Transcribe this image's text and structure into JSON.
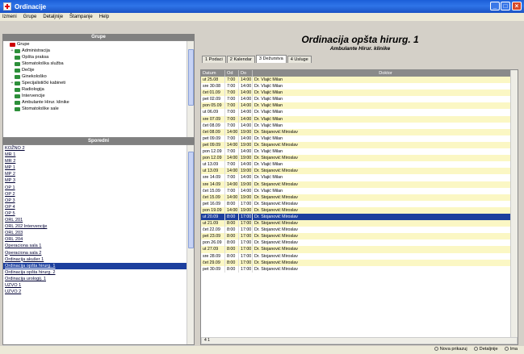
{
  "window": {
    "title": "Ordinacije"
  },
  "menu": [
    "Izmeni",
    "Grupe",
    "Detaljnije",
    "Štampanje",
    "Help"
  ],
  "left": {
    "groups_header": "Grupe",
    "tree": [
      {
        "label": "Grupe",
        "level": 0,
        "expander": "",
        "icon": "red"
      },
      {
        "label": "Administracija",
        "level": 1,
        "expander": "+",
        "icon": "green"
      },
      {
        "label": "Opšta praksa",
        "level": 1,
        "expander": "",
        "icon": "green"
      },
      {
        "label": "Stomatološka služba",
        "level": 1,
        "expander": "",
        "icon": "green"
      },
      {
        "label": "Dečije",
        "level": 1,
        "expander": "",
        "icon": "green"
      },
      {
        "label": "Ginekološko",
        "level": 1,
        "expander": "",
        "icon": "green"
      },
      {
        "label": "Specijalistički kabineti",
        "level": 1,
        "expander": "+",
        "icon": "green"
      },
      {
        "label": "Radiologija",
        "level": 1,
        "expander": "",
        "icon": "green"
      },
      {
        "label": "Intervencije",
        "level": 1,
        "expander": "",
        "icon": "green"
      },
      {
        "label": "Ambulante Hirur. klinike",
        "level": 1,
        "expander": "",
        "icon": "green"
      },
      {
        "label": "Stomatološke sale",
        "level": 1,
        "expander": "",
        "icon": "green"
      }
    ],
    "items_header": "Sporedni",
    "items": [
      "KOŽNO 2",
      "MR 1",
      "MR 2",
      "MP 1",
      "MP 2",
      "MP 3",
      "OP 1",
      "OP 2",
      "OP 3",
      "OP 4",
      "OP 5",
      "ORL 201",
      "ORL 202 Intervencije",
      "ORL 203",
      "ORL 204",
      "Operaciona sala 1",
      "Operaciona sala 2",
      "Ordinacija akušer 1",
      "Ordinacija opšta hirurg. 1",
      "Ordinacija opšta hirurg. 2",
      "Ordinacija urologij. 1",
      "UZVO 1",
      "UZVO 2"
    ],
    "selected_item_index": 18
  },
  "right": {
    "title": "Ordinacija opšta hirurg. 1",
    "subtitle": "Ambulante Hirur. klinike",
    "tabs": [
      "1 Podaci",
      "2 Kalendar",
      "3 Dežurstva",
      "4 Usluge"
    ],
    "active_tab": 2,
    "grid_headers": [
      "Datum",
      "Od",
      "Do",
      "Doktor"
    ],
    "rows": [
      [
        "ut 25.08",
        "7:00",
        "14:00",
        "Dr. Vlajić Milan"
      ],
      [
        "sre 30.08",
        "7:00",
        "14:00",
        "Dr. Vlajić Milan"
      ],
      [
        "čet 01.09",
        "7:00",
        "14:00",
        "Dr. Vlajić Milan"
      ],
      [
        "pet 02.09",
        "7:00",
        "14:00",
        "Dr. Vlajić Milan"
      ],
      [
        "pon 05.09",
        "7:00",
        "14:00",
        "Dr. Vlajić Milan"
      ],
      [
        "ut 06.09",
        "7:00",
        "14:00",
        "Dr. Vlajić Milan"
      ],
      [
        "sre 07.09",
        "7:00",
        "14:00",
        "Dr. Vlajić Milan"
      ],
      [
        "čet 08.09",
        "7:00",
        "14:00",
        "Dr. Vlajić Milan"
      ],
      [
        "čet 08.09",
        "14:00",
        "19:00",
        "Dr. Stojanović Miroslav"
      ],
      [
        "pet 09.09",
        "7:00",
        "14:00",
        "Dr. Vlajić Milan"
      ],
      [
        "pet 09.09",
        "14:00",
        "19:00",
        "Dr. Stojanović Miroslav"
      ],
      [
        "pon 12.09",
        "7:00",
        "14:00",
        "Dr. Vlajić Milan"
      ],
      [
        "pon 12.09",
        "14:00",
        "19:00",
        "Dr. Stojanović Miroslav"
      ],
      [
        "ut 13.09",
        "7:00",
        "14:00",
        "Dr. Vlajić Milan"
      ],
      [
        "ut 13.09",
        "14:00",
        "19:00",
        "Dr. Stojanović Miroslav"
      ],
      [
        "sre 14.09",
        "7:00",
        "14:00",
        "Dr. Vlajić Milan"
      ],
      [
        "sre 14.09",
        "14:00",
        "19:00",
        "Dr. Stojanović Miroslav"
      ],
      [
        "čet 15.09",
        "7:00",
        "14:00",
        "Dr. Vlajić Milan"
      ],
      [
        "čet 15.09",
        "14:00",
        "19:00",
        "Dr. Stojanović Miroslav"
      ],
      [
        "pet 16.09",
        "8:00",
        "17:00",
        "Dr. Stojanović Miroslav"
      ],
      [
        "pon 19.09",
        "14:00",
        "19:00",
        "Dr. Stojanović Miroslav"
      ],
      [
        "ut 20.09",
        "8:00",
        "17:00",
        "Dr. Stojanović Miroslav"
      ],
      [
        "ut 21.09",
        "8:00",
        "17:00",
        "Dr. Stojanović Miroslav"
      ],
      [
        "čet 22.09",
        "8:00",
        "17:00",
        "Dr. Stojanović Miroslav"
      ],
      [
        "pet 23.09",
        "8:00",
        "17:00",
        "Dr. Stojanović Miroslav"
      ],
      [
        "pon 26.09",
        "8:00",
        "17:00",
        "Dr. Stojanović Miroslav"
      ],
      [
        "ut 27.09",
        "8:00",
        "17:00",
        "Dr. Stojanović Miroslav"
      ],
      [
        "sre 28.09",
        "8:00",
        "17:00",
        "Dr. Stojanović Miroslav"
      ],
      [
        "čet 29.09",
        "8:00",
        "17:00",
        "Dr. Stojanović Miroslav"
      ],
      [
        "pet 30.09",
        "8:00",
        "17:00",
        "Dr. Stojanović Miroslav"
      ]
    ],
    "row_tints": [
      "y",
      "w",
      "y",
      "w",
      "y",
      "w",
      "y",
      "w",
      "y",
      "w",
      "y",
      "w",
      "y",
      "w",
      "y",
      "w",
      "y",
      "w",
      "y",
      "w",
      "y",
      "sel",
      "y",
      "w",
      "y",
      "w",
      "y",
      "w",
      "y",
      "w"
    ],
    "grid_footer": "4 1"
  },
  "status": {
    "option1": "Nova prikazuj",
    "option2": "Detaljnije",
    "option3": "Ima"
  },
  "colors": {
    "titlebar": "#1c5fd8",
    "selection": "#1c3f9e",
    "row_tint": "#fbf7c4"
  }
}
